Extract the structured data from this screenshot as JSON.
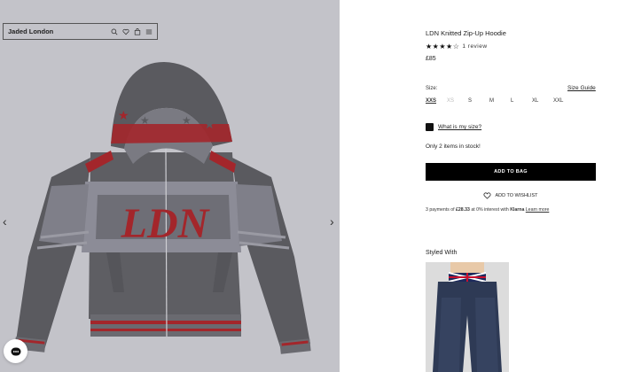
{
  "header": {
    "brand": "Jaded London",
    "icons": [
      "search-icon",
      "heart-icon",
      "bag-icon",
      "menu-icon"
    ]
  },
  "gallery": {
    "prev_arrow": "‹",
    "next_arrow": "›",
    "image_text": "LDN"
  },
  "product": {
    "title": "LDN Knitted Zip-Up Hoodie",
    "stars": "★★★★☆",
    "rating": 4,
    "reviews": "1 review",
    "price": "£85",
    "size_label": "Size:",
    "size_guide": "Size Guide",
    "sizes": [
      {
        "label": "XXS",
        "state": "selected"
      },
      {
        "label": "XS",
        "state": "unavailable"
      },
      {
        "label": "S",
        "state": "available"
      },
      {
        "label": "M",
        "state": "available"
      },
      {
        "label": "L",
        "state": "available"
      },
      {
        "label": "XL",
        "state": "available"
      },
      {
        "label": "XXL",
        "state": "available"
      }
    ],
    "what_size": "What is my size?",
    "stock": "Only 2 items in stock!",
    "add_to_bag": "ADD TO BAG",
    "add_to_wishlist": "ADD TO WISHLIST",
    "klarna": {
      "prefix": "3 payments of ",
      "amount": "£28.33",
      "middle": " at 0% interest with ",
      "brand": "Klarna",
      "link": "Learn more"
    },
    "styled_with": "Styled With"
  },
  "colors": {
    "panel_bg": "#c3c3c9",
    "button_bg": "#000000",
    "hoodie_dark": "#5a5a5f",
    "hoodie_light": "#8a8a95",
    "hoodie_red": "#a3262b"
  }
}
